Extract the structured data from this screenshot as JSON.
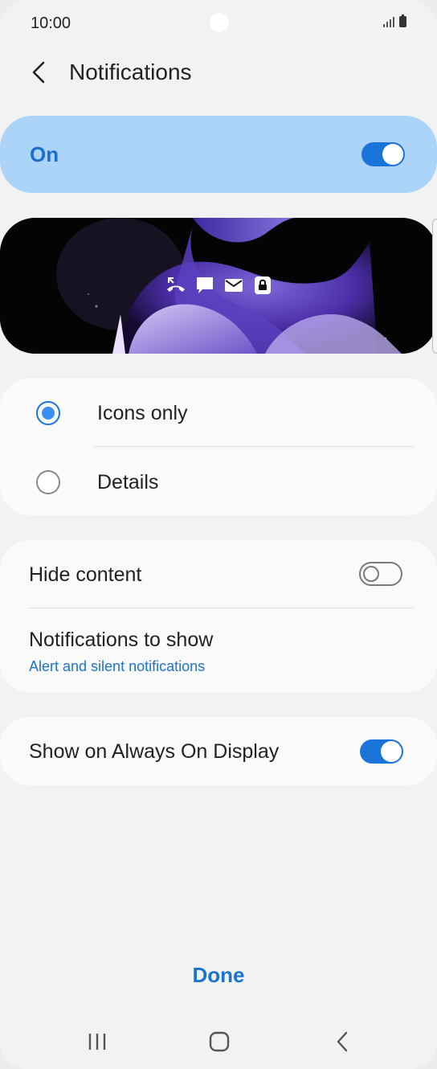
{
  "status_bar": {
    "time": "10:00"
  },
  "header": {
    "title": "Notifications"
  },
  "master_switch": {
    "label": "On",
    "state": "on"
  },
  "preview": {
    "icons": [
      "missed-call-icon",
      "message-icon",
      "mail-icon",
      "lock-icon"
    ]
  },
  "style_options": {
    "items": [
      {
        "label": "Icons only",
        "selected": true
      },
      {
        "label": "Details",
        "selected": false
      }
    ]
  },
  "content_settings": {
    "hide_content": {
      "label": "Hide content",
      "state": "off"
    },
    "notifications_to_show": {
      "label": "Notifications to show",
      "value": "Alert and silent notifications"
    }
  },
  "aod": {
    "label": "Show on Always On Display",
    "state": "on"
  },
  "footer": {
    "done_label": "Done"
  },
  "colors": {
    "accent": "#1b74d9",
    "on_card": "#acd3f8",
    "background": "#f2f2f2"
  }
}
